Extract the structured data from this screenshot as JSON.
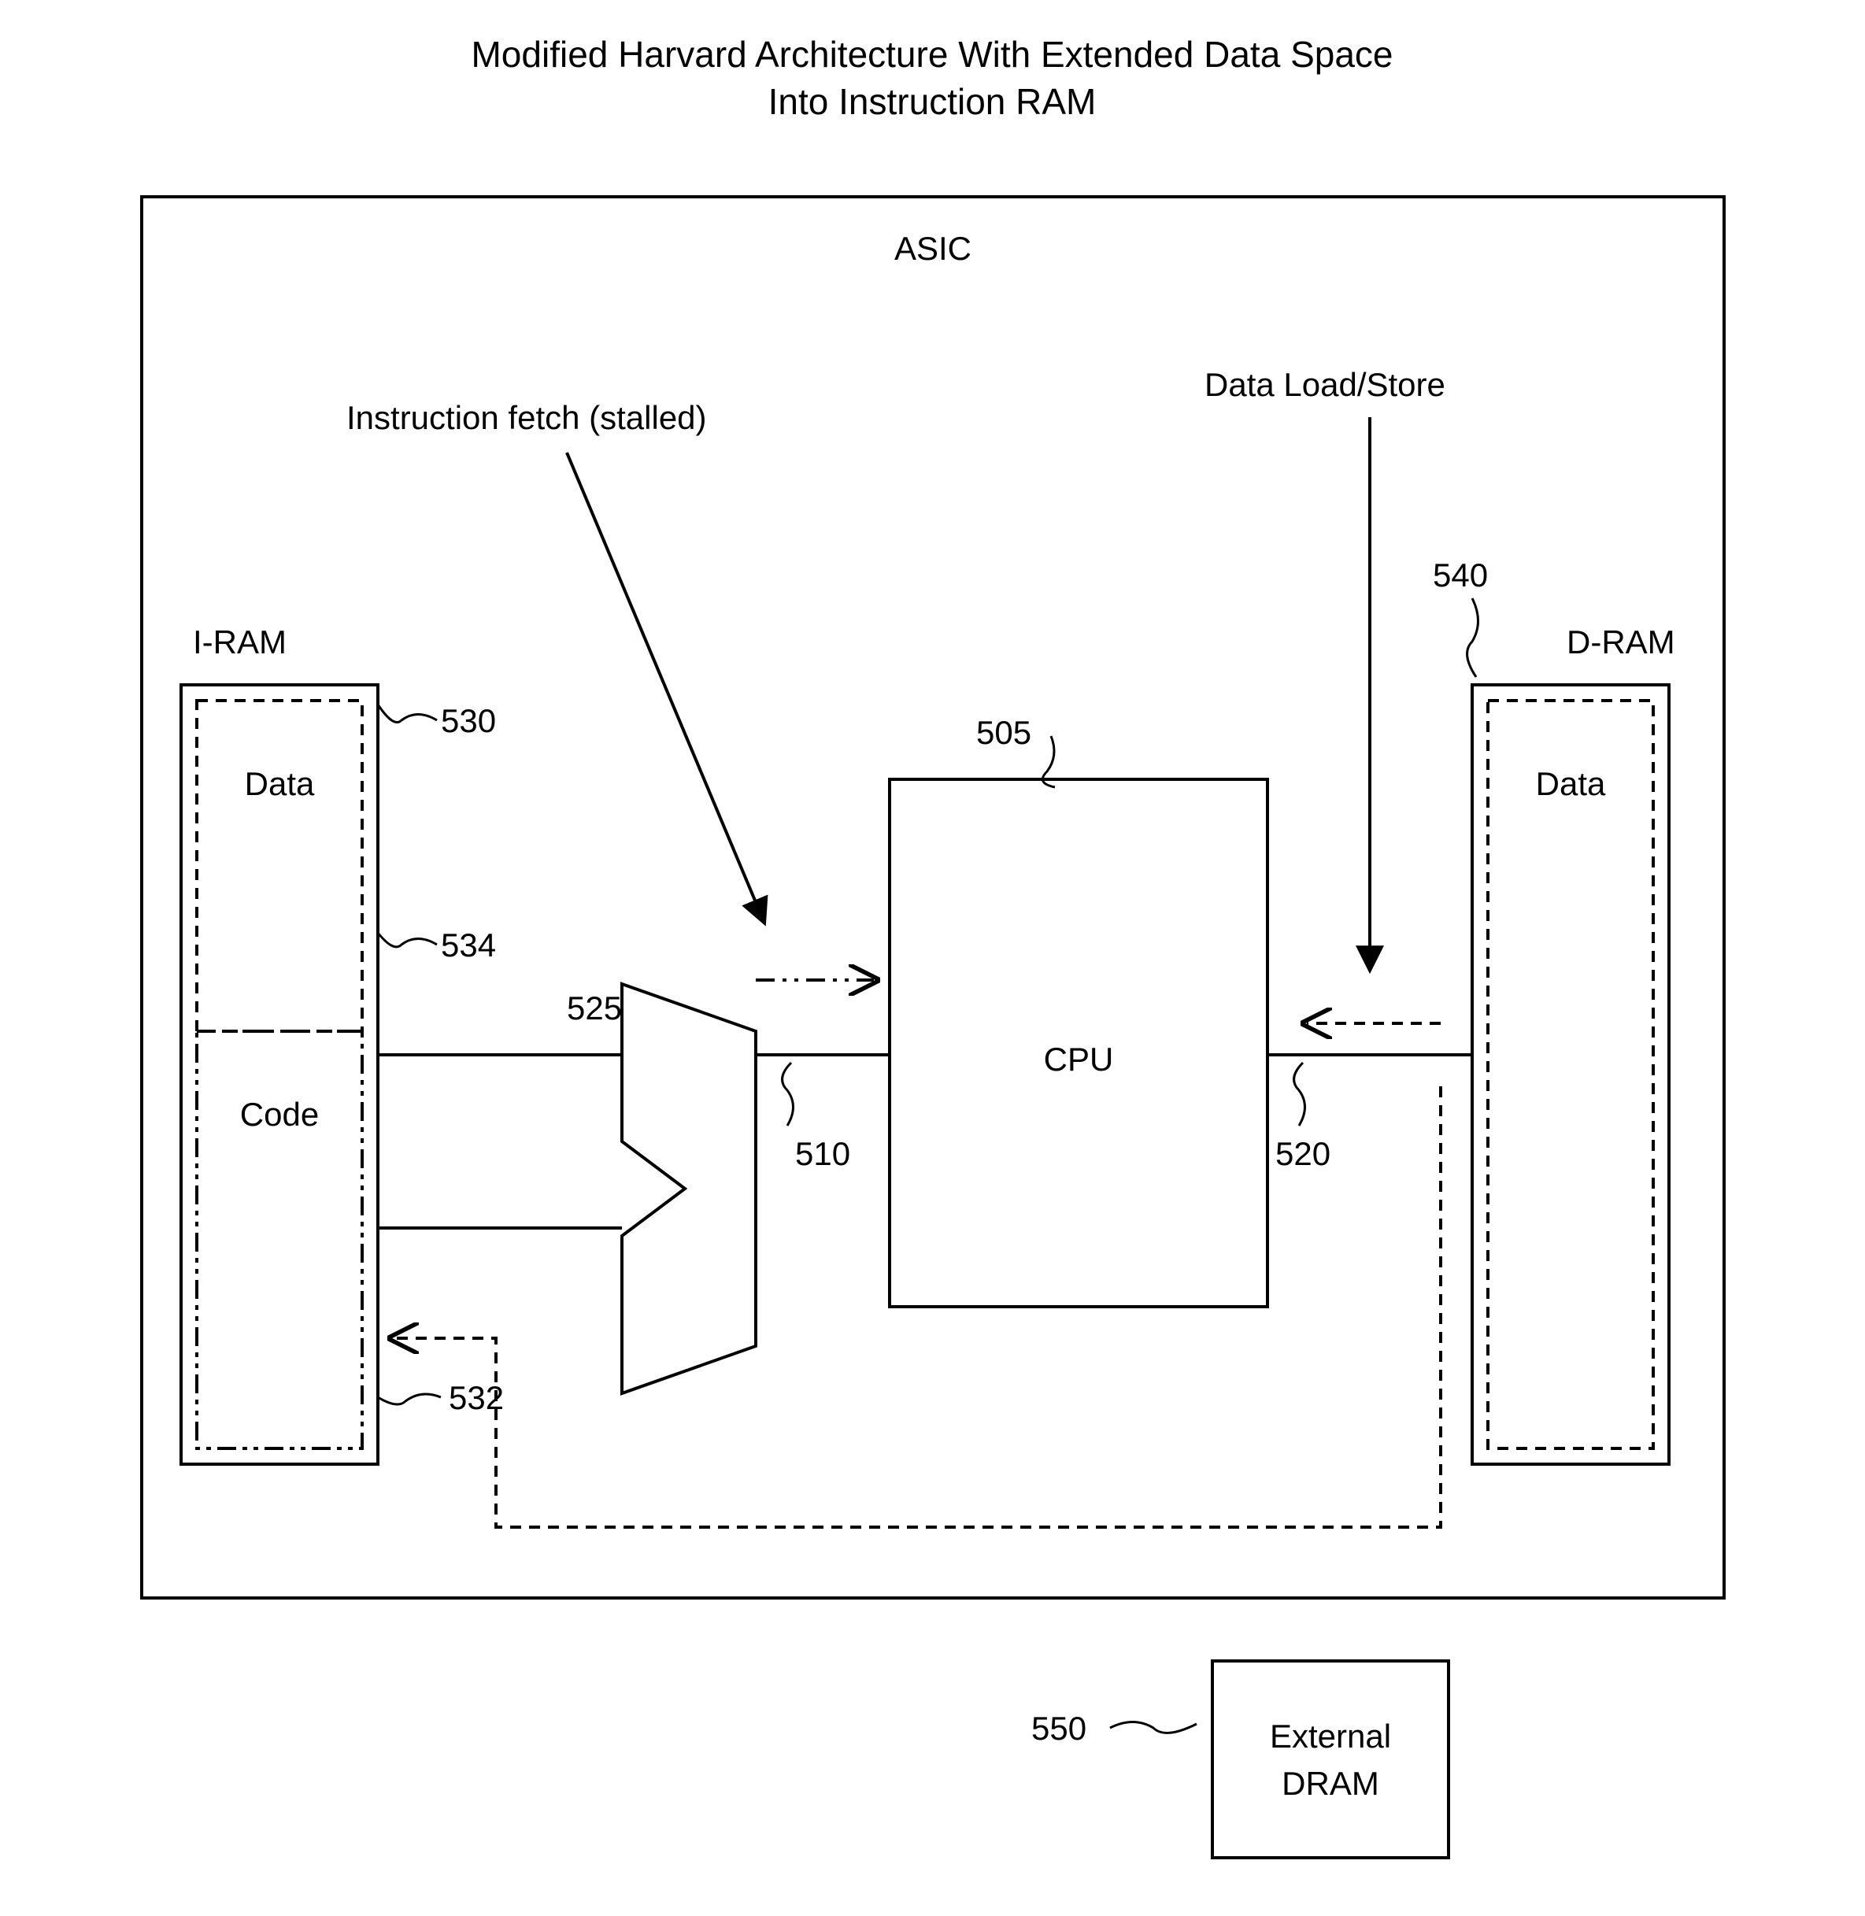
{
  "title1": "Modified Harvard Architecture With Extended Data Space",
  "title2": "Into Instruction RAM",
  "asic": "ASIC",
  "cpu": "CPU",
  "iram": "I-RAM",
  "dram": "D-RAM",
  "ext": "External",
  "ext2": "DRAM",
  "ifetch": "Instruction fetch (stalled)",
  "dload": "Data Load/Store",
  "data": "Data",
  "code": "Code",
  "n505": "505",
  "n510": "510",
  "n520": "520",
  "n525": "525",
  "n530": "530",
  "n532": "532",
  "n534": "534",
  "n540": "540",
  "n550": "550"
}
